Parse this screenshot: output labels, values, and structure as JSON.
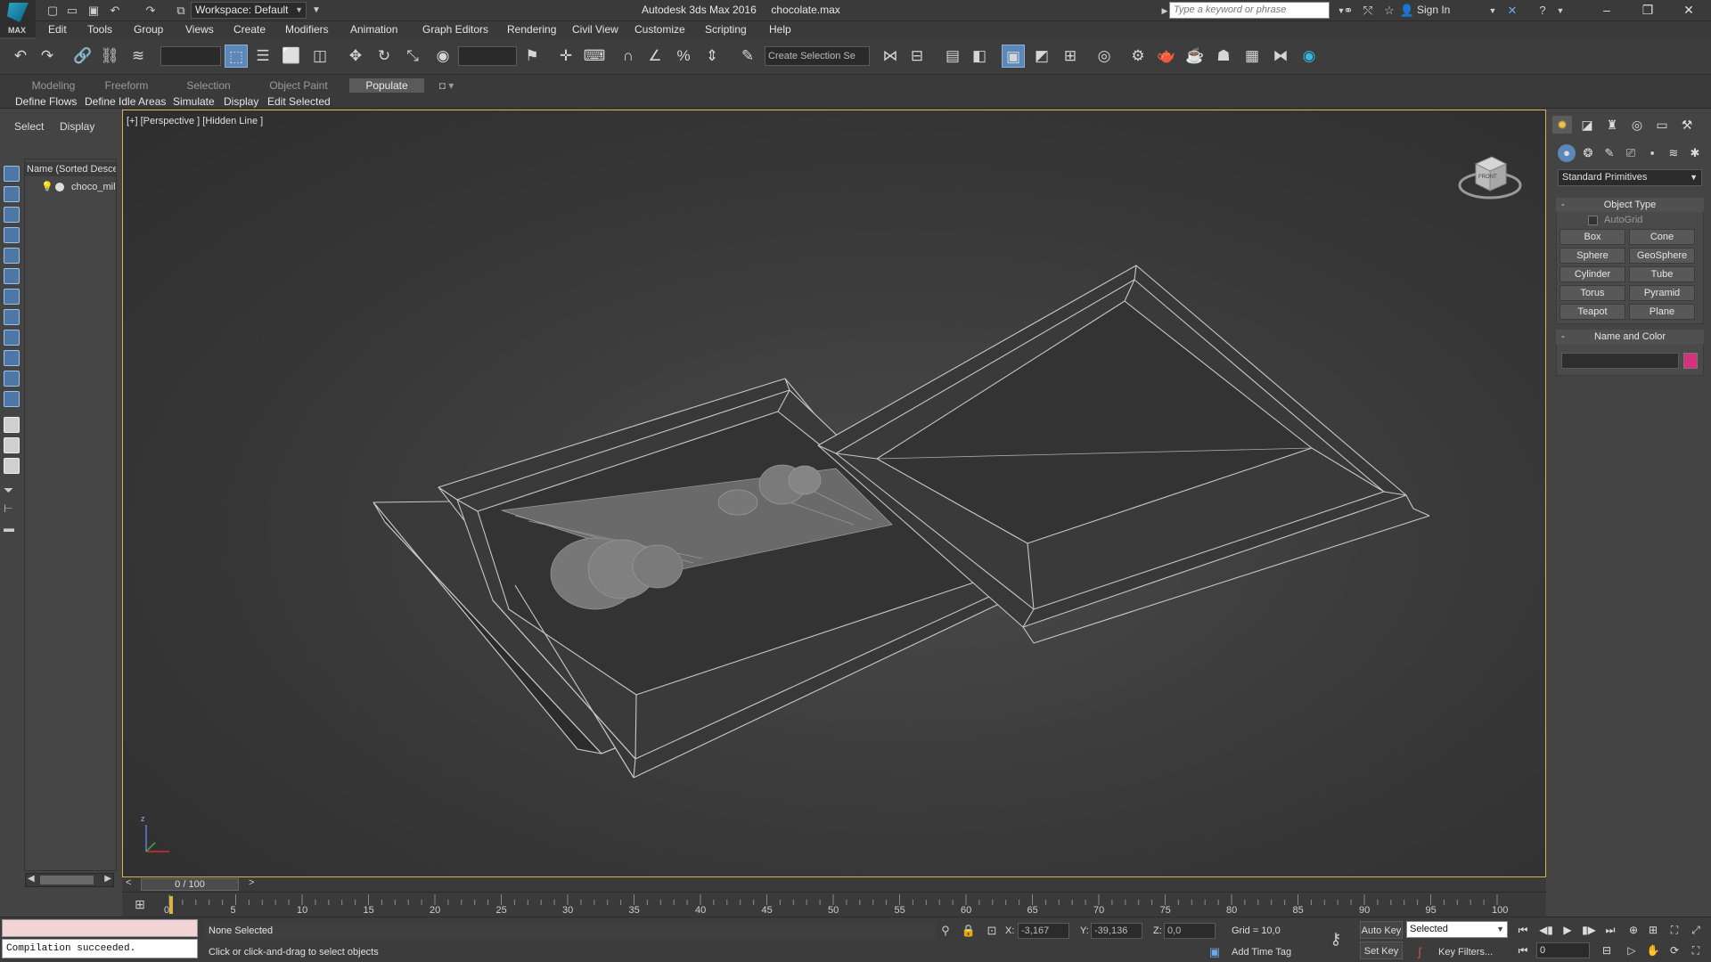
{
  "titlebar": {
    "workspace": "Workspace: Default",
    "app_title": "Autodesk 3ds Max 2016",
    "file_name": "chocolate.max",
    "search_placeholder": "Type a keyword or phrase",
    "sign_in": "Sign In",
    "logo_text": "MAX"
  },
  "menu": [
    "Edit",
    "Tools",
    "Group",
    "Views",
    "Create",
    "Modifiers",
    "Animation",
    "Graph Editors",
    "Rendering",
    "Civil View",
    "Customize",
    "Scripting",
    "Help"
  ],
  "toolbar": {
    "selection_set_placeholder": "Create Selection Se"
  },
  "ribbon": {
    "tabs": [
      "Modeling",
      "Freeform",
      "Selection",
      "Object Paint",
      "Populate"
    ],
    "active_tab": "Populate",
    "buttons": [
      "Define Flows",
      "Define Idle Areas",
      "Simulate",
      "Display",
      "Edit Selected"
    ]
  },
  "scene_explorer": {
    "tabs": [
      "Select",
      "Display"
    ],
    "column_header": "Name (Sorted Desce",
    "items": [
      {
        "name": "choco_mil"
      }
    ]
  },
  "viewport": {
    "label": "[+] [Perspective ] [Hidden Line ]",
    "viewcube_face": "FRONT"
  },
  "command_panel": {
    "category": "Standard Primitives",
    "object_type_title": "Object Type",
    "autogrid_label": "AutoGrid",
    "buttons": [
      "Box",
      "Cone",
      "Sphere",
      "GeoSphere",
      "Cylinder",
      "Tube",
      "Torus",
      "Pyramid",
      "Teapot",
      "Plane"
    ],
    "name_color_title": "Name and Color",
    "swatch_color": "#d6317f"
  },
  "timeline": {
    "position": "0 / 100",
    "ticks": [
      "0",
      "5",
      "10",
      "15",
      "20",
      "25",
      "30",
      "35",
      "40",
      "45",
      "50",
      "55",
      "60",
      "65",
      "70",
      "75",
      "80",
      "85",
      "90",
      "95",
      "100"
    ]
  },
  "status": {
    "maxscript_output": "Compilation succeeded.",
    "selection_status": "None Selected",
    "prompt": "Click or click-and-drag to select objects",
    "x_label": "X:",
    "x_value": "-3,167",
    "y_label": "Y:",
    "y_value": "-39,136",
    "z_label": "Z:",
    "z_value": "0,0",
    "grid": "Grid = 10,0",
    "add_time_tag": "Add Time Tag",
    "auto_key": "Auto Key",
    "set_key": "Set Key",
    "key_mode": "Selected",
    "key_filters": "Key Filters...",
    "current_frame": "0"
  },
  "colors": {
    "viewport_border": "#d8b24a",
    "active_tool": "#5b87b9",
    "wire": "#c8c8c8"
  }
}
